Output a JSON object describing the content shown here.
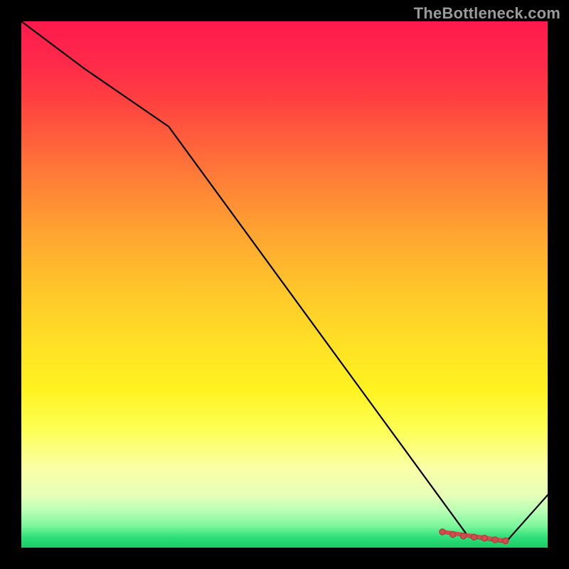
{
  "watermark": "TheBottleneck.com",
  "chart_data": {
    "type": "line",
    "title": "",
    "xlabel": "",
    "ylabel": "",
    "xlim": [
      0,
      100
    ],
    "ylim": [
      0,
      100
    ],
    "series": [
      {
        "name": "curve",
        "x": [
          0,
          12,
          28,
          85,
          92,
          100
        ],
        "values": [
          100,
          91,
          80,
          2,
          1,
          10
        ]
      }
    ],
    "markers": {
      "name": "highlight-segment",
      "x": [
        80,
        82,
        84,
        86,
        88,
        90,
        92
      ],
      "values": [
        3,
        2.5,
        2.2,
        2.0,
        1.8,
        1.5,
        1.3
      ]
    },
    "background_gradient": {
      "top": "#ff1a4d",
      "mid": "#ffe225",
      "bottom": "#1acc66"
    }
  }
}
